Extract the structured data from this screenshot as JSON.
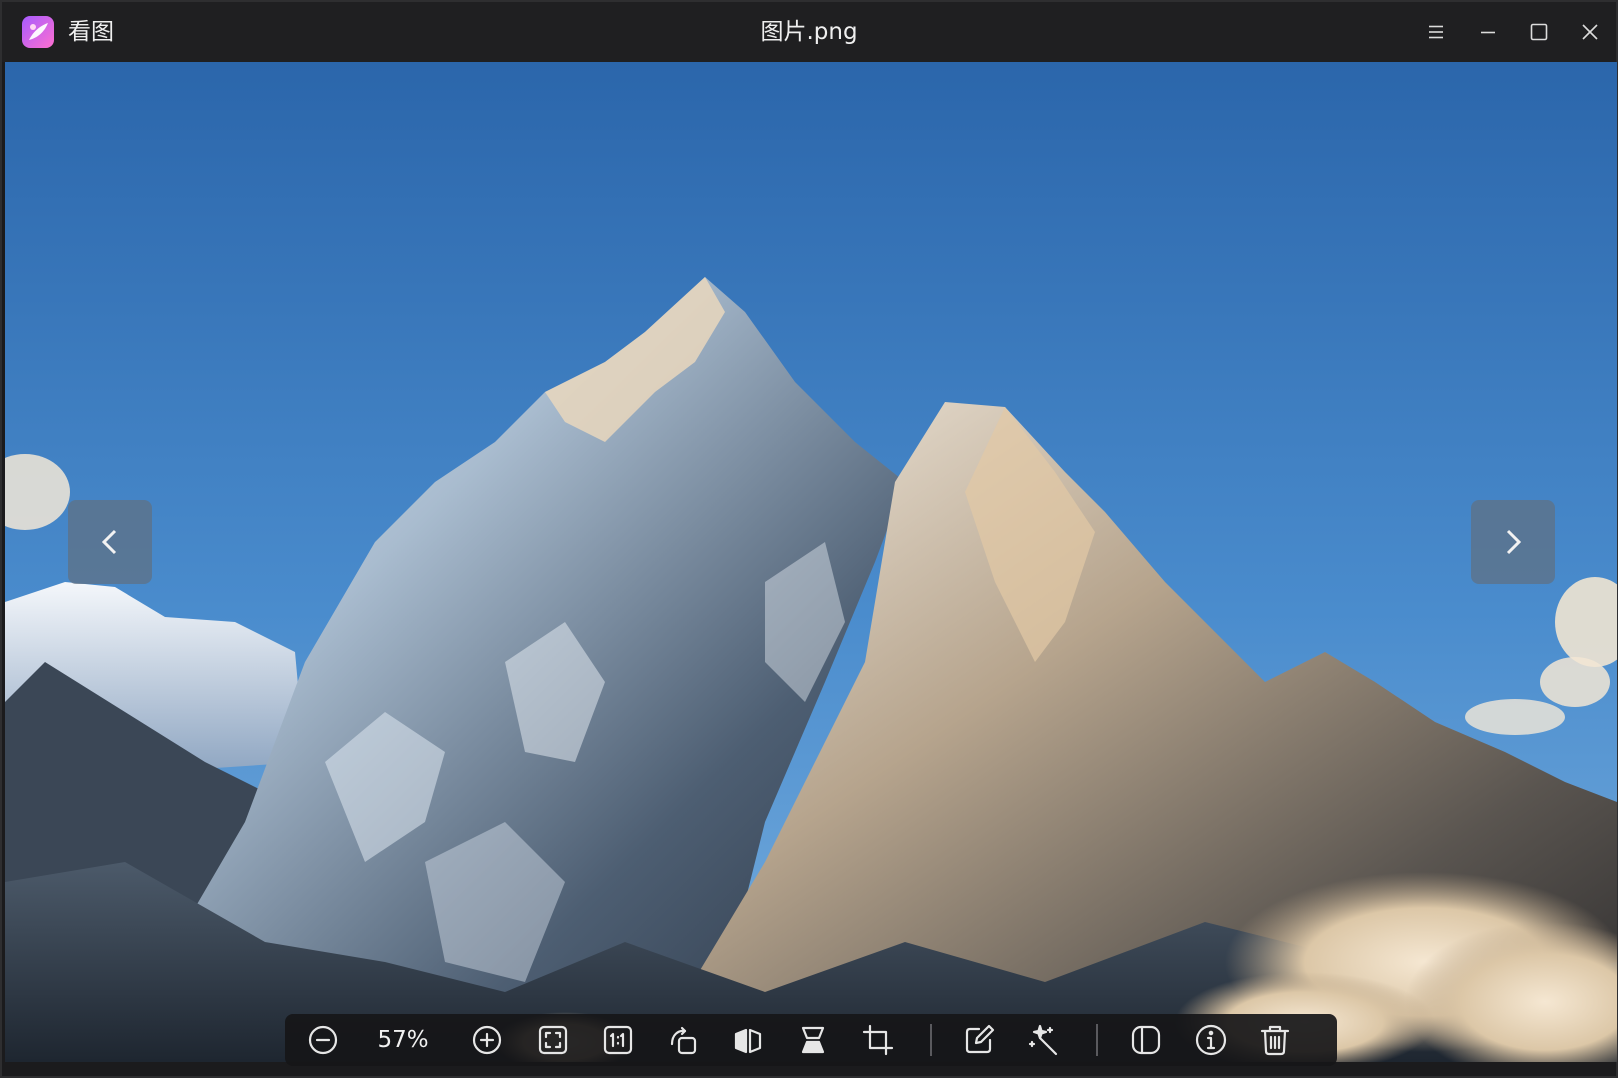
{
  "window": {
    "app_name": "看图",
    "document_title": "图片.png",
    "controls": {
      "menu_icon": "menu-icon",
      "minimize_icon": "minimize-icon",
      "maximize_icon": "maximize-icon",
      "close_icon": "close-icon"
    }
  },
  "viewer": {
    "prev_icon": "chevron-left-icon",
    "next_icon": "chevron-right-icon"
  },
  "toolbar": {
    "zoom_level": "57%",
    "tools": [
      "zoom-out-icon",
      "zoom-in-icon",
      "fit-window-icon",
      "actual-size-icon",
      "rotate-icon",
      "flip-horizontal-icon",
      "flip-vertical-icon",
      "crop-icon",
      "edit-icon",
      "magic-wand-icon",
      "compare-icon",
      "info-icon",
      "delete-icon"
    ]
  },
  "colors": {
    "titlebar_bg": "#1f1f21",
    "sky_top": "#2b66ab",
    "sky_bottom": "#6aa3d6",
    "toolbar_bg": "#161618",
    "nav_button_bg": "#5f7082"
  }
}
